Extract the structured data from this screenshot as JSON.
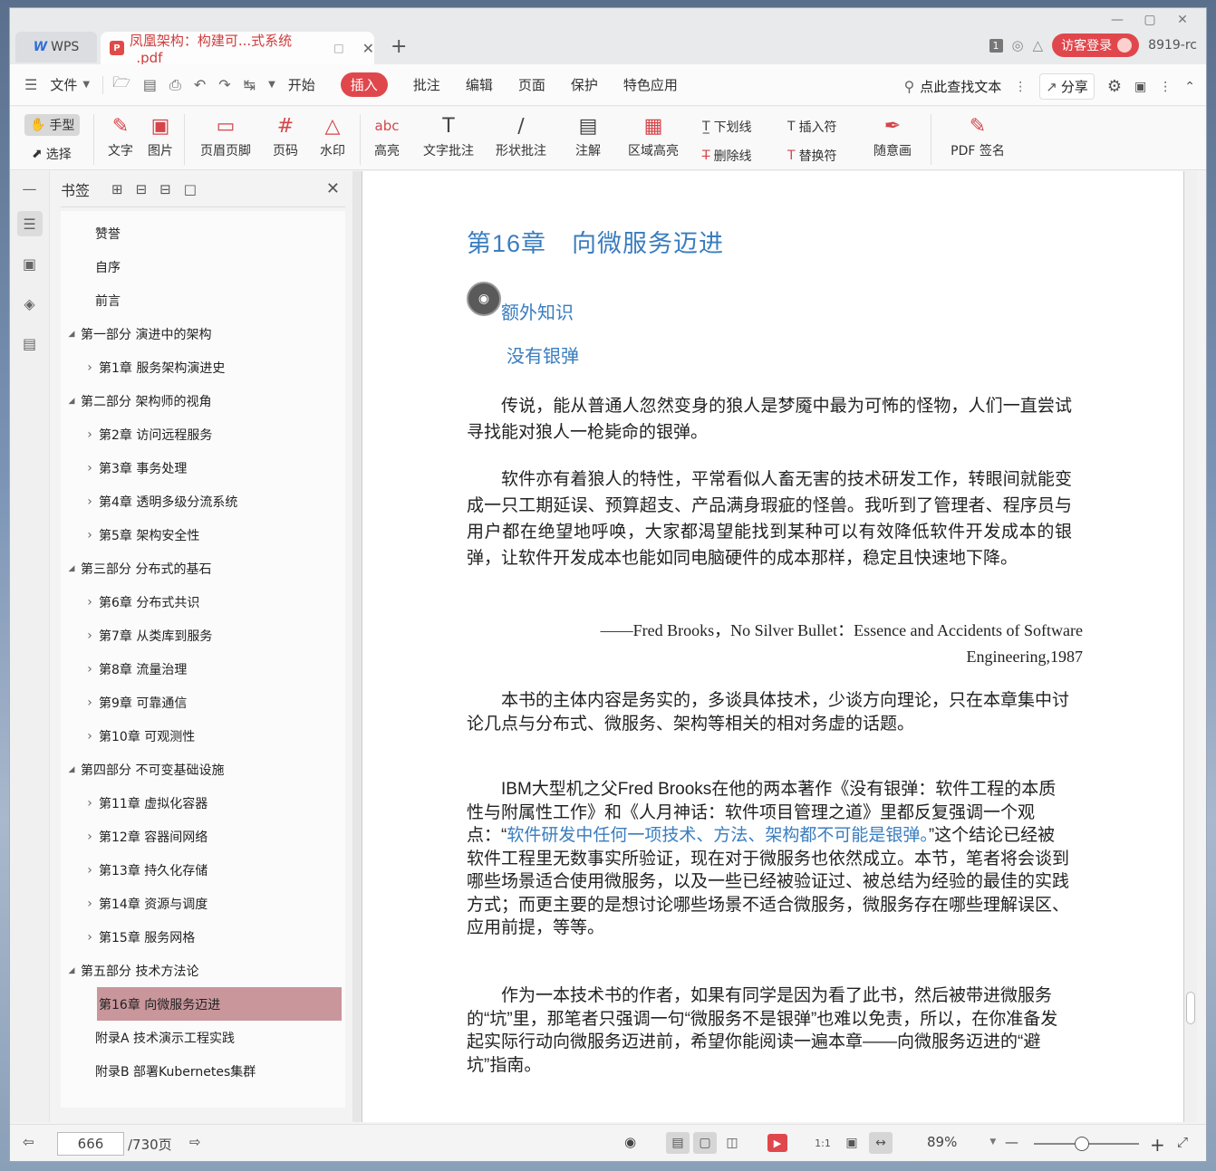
{
  "window": {
    "wps_tab": "WPS",
    "doc_tab_title": "凤凰架构：构建可...式系统_.pdf",
    "login": "访客登录",
    "version": "8919-rc",
    "page_badge": "1"
  },
  "menu": {
    "file": "文件",
    "tabs": [
      "开始",
      "插入",
      "批注",
      "编辑",
      "页面",
      "保护",
      "特色应用"
    ],
    "search": "点此查找文本",
    "share": "分享"
  },
  "ribbon": {
    "hand": "手型",
    "select": "选择",
    "text": "文字",
    "image": "图片",
    "header_footer": "页眉页脚",
    "page_num": "页码",
    "watermark": "水印",
    "highlight": "高亮",
    "text_comment": "文字批注",
    "shape_comment": "形状批注",
    "note": "注解",
    "area_highlight": "区域高亮",
    "underline": "下划线",
    "strikethrough": "删除线",
    "insert_char": "插入符",
    "replace_char": "替换符",
    "freehand": "随意画",
    "pdf_sign": "PDF 签名"
  },
  "bookmarks": {
    "title": "书签",
    "items": [
      {
        "label": "赞誉",
        "level": "top"
      },
      {
        "label": "自序",
        "level": "top"
      },
      {
        "label": "前言",
        "level": "top"
      },
      {
        "label": "第一部分 演进中的架构",
        "level": "part"
      },
      {
        "label": "第1章 服务架构演进史",
        "level": "chapter"
      },
      {
        "label": "第二部分 架构师的视角",
        "level": "part"
      },
      {
        "label": "第2章 访问远程服务",
        "level": "chapter"
      },
      {
        "label": "第3章 事务处理",
        "level": "chapter"
      },
      {
        "label": "第4章 透明多级分流系统",
        "level": "chapter"
      },
      {
        "label": "第5章 架构安全性",
        "level": "chapter"
      },
      {
        "label": "第三部分 分布式的基石",
        "level": "part"
      },
      {
        "label": "第6章 分布式共识",
        "level": "chapter"
      },
      {
        "label": "第7章 从类库到服务",
        "level": "chapter"
      },
      {
        "label": "第8章 流量治理",
        "level": "chapter"
      },
      {
        "label": "第9章 可靠通信",
        "level": "chapter"
      },
      {
        "label": "第10章 可观测性",
        "level": "chapter"
      },
      {
        "label": "第四部分 不可变基础设施",
        "level": "part"
      },
      {
        "label": "第11章 虚拟化容器",
        "level": "chapter"
      },
      {
        "label": "第12章 容器间网络",
        "level": "chapter"
      },
      {
        "label": "第13章 持久化存储",
        "level": "chapter"
      },
      {
        "label": "第14章 资源与调度",
        "level": "chapter"
      },
      {
        "label": "第15章 服务网格",
        "level": "chapter"
      },
      {
        "label": "第五部分 技术方法论",
        "level": "part"
      },
      {
        "label": "第16章 向微服务迈进",
        "level": "chapter",
        "selected": true
      },
      {
        "label": "附录A 技术演示工程实践",
        "level": "top"
      },
      {
        "label": "附录B 部署Kubernetes集群",
        "level": "top"
      }
    ]
  },
  "page": {
    "chapter_title": "第16章　向微服务迈进",
    "extra_title": "额外知识",
    "sub_title": "没有银弹",
    "para1": "传说，能从普通人忽然变身的狼人是梦魇中最为可怖的怪物，人们一直尝试寻找能对狼人一枪毙命的银弹。",
    "para2": "软件亦有着狼人的特性，平常看似人畜无害的技术研发工作，转眼间就能变成一只工期延误、预算超支、产品满身瑕疵的怪兽。我听到了管理者、程序员与用户都在绝望地呼唤，大家都渴望能找到某种可以有效降低软件开发成本的银弹，让软件开发成本也能如同电脑硬件的成本那样，稳定且快速地下降。",
    "quote_line1": "——Fred Brooks，No Silver Bullet：Essence and Accidents of Software",
    "quote_line2": "Engineering,1987",
    "para3": "本书的主体内容是务实的，多谈具体技术，少谈方向理论，只在本章集中讨论几点与分布式、微服务、架构等相关的相对务虚的话题。",
    "para4_a": "IBM大型机之父Fred Brooks在他的两本著作《没有银弹：软件工程的本质性与附属性工作》和《人月神话：软件项目管理之道》里都反复强调一个观点：“",
    "para4_hl": "软件研发中任何一项技术、方法、架构都不可能是银弹。",
    "para4_b": "”这个结论已经被软件工程里无数事实所验证，现在对于微服务也依然成立。本节，笔者将会谈到哪些场景适合使用微服务，以及一些已经被验证过、被总结为经验的最佳的实践方式；而更主要的是想讨论哪些场景不适合微服务，微服务存在哪些理解误区、应用前提，等等。",
    "para5": "作为一本技术书的作者，如果有同学是因为看了此书，然后被带进微服务的“坑”里，那笔者只强调一句“微服务不是银弹”也难以免责，所以，在你准备发起实际行动向微服务迈进前，希望你能阅读一遍本章——向微服务迈进的“避坑”指南。"
  },
  "status": {
    "current_page": "666",
    "total_pages": "/730页",
    "zoom": "89%",
    "zoom_level": 0.45
  },
  "colors": {
    "accent": "#e0474c",
    "heading_blue": "#3a7dbf",
    "selected_bookmark": "#c8969b"
  }
}
